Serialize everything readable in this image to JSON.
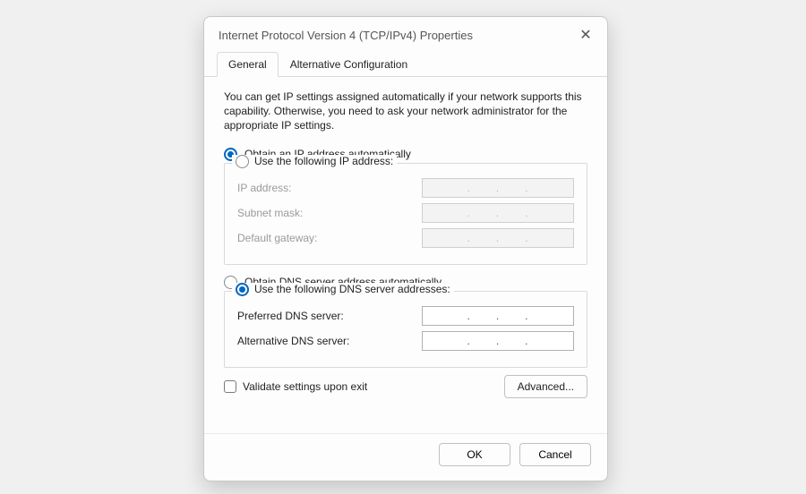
{
  "titlebar": {
    "title": "Internet Protocol Version 4 (TCP/IPv4) Properties"
  },
  "tabs": {
    "general": "General",
    "alt": "Alternative Configuration"
  },
  "description": "You can get IP settings assigned automatically if your network supports this capability. Otherwise, you need to ask your network administrator for the appropriate IP settings.",
  "ip": {
    "auto_label": "Obtain an IP address automatically",
    "manual_label": "Use the following IP address:",
    "selected": "auto",
    "fields": {
      "ip_address": {
        "label": "IP address:",
        "value": ""
      },
      "subnet_mask": {
        "label": "Subnet mask:",
        "value": ""
      },
      "default_gateway": {
        "label": "Default gateway:",
        "value": ""
      }
    }
  },
  "dns": {
    "auto_label": "Obtain DNS server address automatically",
    "manual_label": "Use the following DNS server addresses:",
    "selected": "manual",
    "fields": {
      "preferred": {
        "label": "Preferred DNS server:",
        "value": ""
      },
      "alternative": {
        "label": "Alternative DNS server:",
        "value": ""
      }
    }
  },
  "validate_label": "Validate settings upon exit",
  "validate_checked": false,
  "buttons": {
    "advanced": "Advanced...",
    "ok": "OK",
    "cancel": "Cancel"
  }
}
